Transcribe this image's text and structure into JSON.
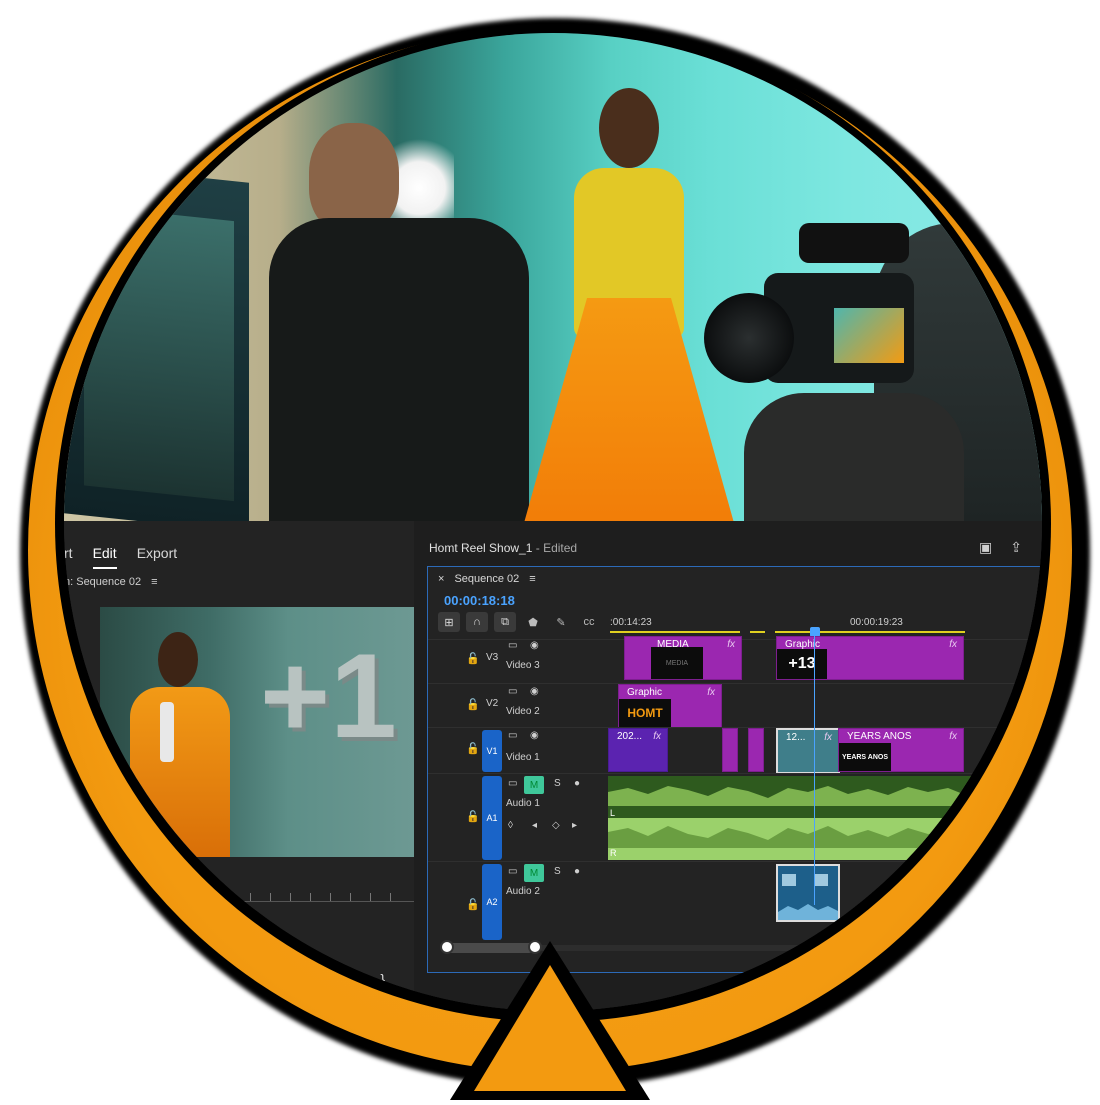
{
  "colors": {
    "ring_orange": "#f39a10",
    "timecode_blue": "#4aa3ff",
    "clip_purple": "#9b27b0",
    "track_blue": "#1a64c8",
    "mute_green": "#3fc79a",
    "audio_green": "#5f8a3c"
  },
  "left_panel": {
    "tabs": [
      "rt",
      "Edit",
      "Export"
    ],
    "program_header": "n: Sequence 02",
    "menu_icon": "hamburger-icon",
    "overlay_text": "+1"
  },
  "project": {
    "title": "Homt Reel Show_1",
    "status": "- Edited"
  },
  "sequence": {
    "tab_label": "Sequence 02",
    "timecode": "00:00:18:18",
    "ruler_left": ":00:14:23",
    "ruler_right": "00:00:19:23"
  },
  "tracks": {
    "v3": {
      "id": "V3",
      "name": "Video 3"
    },
    "v2": {
      "id": "V2",
      "name": "Video 2"
    },
    "v1": {
      "id": "V1",
      "name": "Video 1"
    },
    "a1": {
      "id": "A1",
      "name": "Audio 1",
      "m": "M",
      "s": "S"
    },
    "a2": {
      "id": "A2",
      "name": "Audio 2",
      "m": "M",
      "s": "S"
    }
  },
  "clips": {
    "v3_media": "MEDIA",
    "v3_media_thumb": "MEDIA",
    "v3_graphic": "Graphic",
    "v3_graphic_thumb": "+13",
    "v2_graphic": "Graphic",
    "v2_thumb": "HOMT",
    "v1_a": "202...",
    "v1_b": "12...",
    "v1_c": "YEARS ANOS",
    "v1_c_thumb": "YEARS ANOS",
    "fx": "fx",
    "audio_L": "L",
    "audio_R": "R"
  }
}
